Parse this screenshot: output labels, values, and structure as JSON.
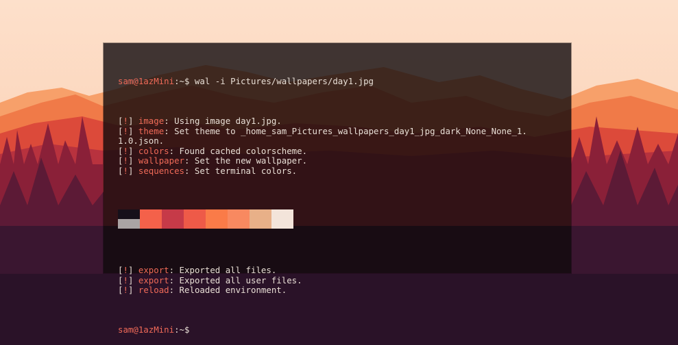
{
  "terminal": {
    "prompt_user": "sam@1azMini",
    "prompt_sep": ":~$",
    "command": " wal -i Pictures/wallpapers/day1.jpg",
    "bracket_open": "[",
    "bang": "!",
    "bracket_close": "]",
    "lines_before": [
      {
        "key": "image",
        "text": ": Using image day1.jpg."
      },
      {
        "key": "theme",
        "text": ": Set theme to _home_sam_Pictures_wallpapers_day1_jpg_dark_None_None_1."
      },
      {
        "key": "",
        "text": "1.0.json."
      },
      {
        "key": "colors",
        "text": ": Found cached colorscheme."
      },
      {
        "key": "wallpaper",
        "text": ": Set the new wallpaper."
      },
      {
        "key": "sequences",
        "text": ": Set terminal colors."
      }
    ],
    "lines_after": [
      {
        "key": "export",
        "text": ": Exported all files."
      },
      {
        "key": "export",
        "text": ": Exported all user files."
      },
      {
        "key": "reload",
        "text": ": Reloaded environment."
      }
    ],
    "final_prompt_user": "sam@1azMini",
    "final_prompt_sep": ":~$"
  },
  "colors": {
    "accent": "#f06a58",
    "foreground": "#e9dfd6",
    "terminal_bg": "#100a0c",
    "palette_top": [
      "#16101a",
      "#f4614a",
      "#c63a48",
      "#ee5a48",
      "#fa7b48",
      "#f88960",
      "#e8b088",
      "#f3e4da"
    ],
    "palette_bottom": [
      "#aaa4a4",
      "#f4614a",
      "#c63a48",
      "#ee5a48",
      "#fa7b48",
      "#f88960",
      "#e8b088",
      "#f3e4da"
    ]
  }
}
